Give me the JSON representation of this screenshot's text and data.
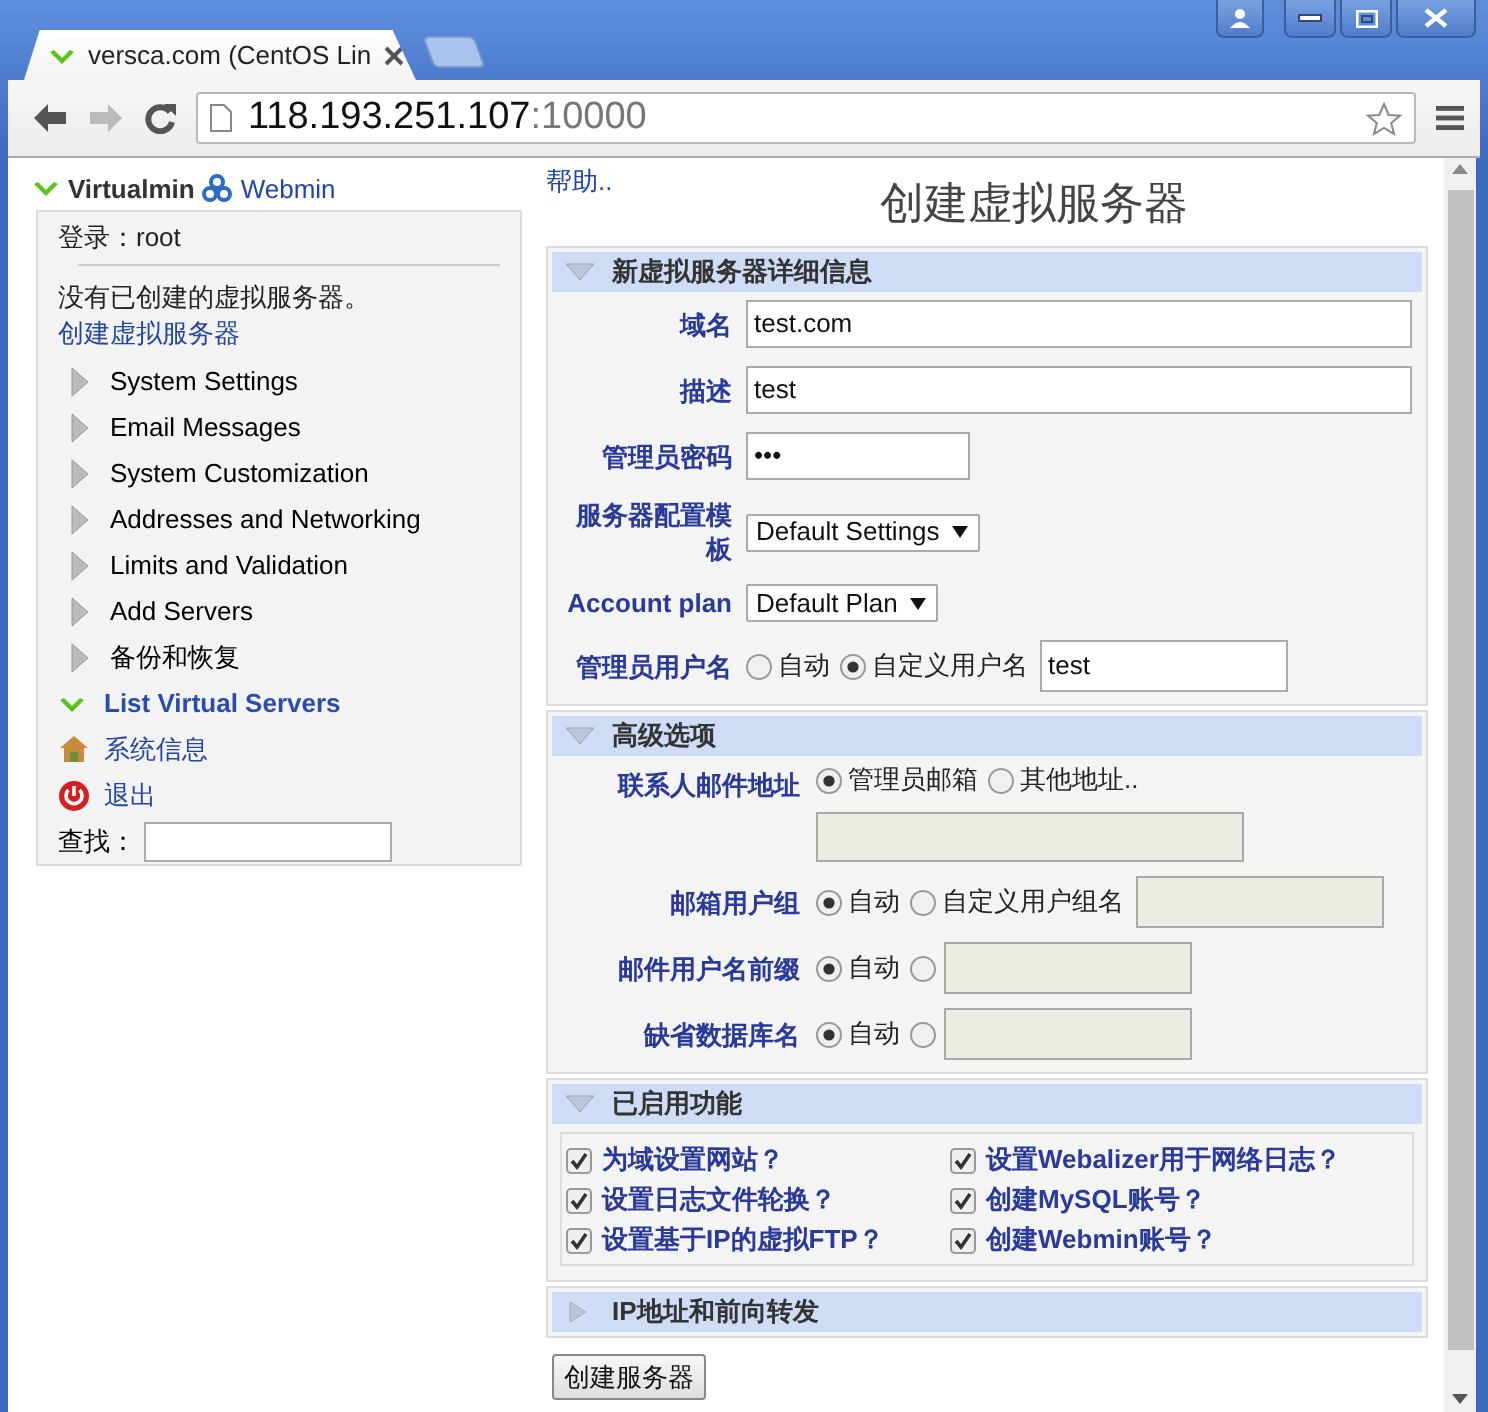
{
  "browser": {
    "tab_title": "versca.com (CentOS Lin",
    "url_host": "118.193.251.107",
    "url_port": ":10000"
  },
  "sidebar": {
    "brand": "Virtualmin",
    "webmin": "Webmin",
    "login": "登录：root",
    "notice": "没有已创建的虚拟服务器。",
    "create_link": "创建虚拟服务器",
    "menu": [
      {
        "label": "System Settings",
        "kind": "category"
      },
      {
        "label": "Email Messages",
        "kind": "category"
      },
      {
        "label": "System Customization",
        "kind": "category"
      },
      {
        "label": "Addresses and Networking",
        "kind": "category"
      },
      {
        "label": "Limits and Validation",
        "kind": "category"
      },
      {
        "label": "Add Servers",
        "kind": "category"
      },
      {
        "label": "备份和恢复",
        "kind": "category"
      },
      {
        "label": "List Virtual Servers",
        "kind": "open"
      },
      {
        "label": "系统信息",
        "kind": "home"
      },
      {
        "label": "退出",
        "kind": "logout"
      }
    ],
    "search_label": "查找："
  },
  "help_link": "帮助..",
  "page_title": "创建虚拟服务器",
  "sections": [
    {
      "title": "新虚拟服务器详细信息",
      "expanded": true,
      "rows": [
        {
          "kind": "text",
          "label": "域名",
          "value": "test.com"
        },
        {
          "kind": "text",
          "label": "描述",
          "value": "test"
        },
        {
          "kind": "password",
          "label": "管理员密码",
          "value": "•••"
        },
        {
          "kind": "select",
          "label": "服务器配置模板",
          "value": "Default Settings"
        },
        {
          "kind": "select",
          "label": "Account plan",
          "value": "Default Plan"
        },
        {
          "kind": "radio",
          "label": "管理员用户名",
          "options": [
            {
              "label": "自动",
              "selected": false
            },
            {
              "label": "自定义用户名",
              "selected": true
            }
          ],
          "field": {
            "value": "test",
            "disabled": false
          }
        }
      ]
    },
    {
      "title": "高级选项",
      "expanded": true,
      "rows": [
        {
          "kind": "radio_stacked",
          "label": "联系人邮件地址",
          "options": [
            {
              "label": "管理员邮箱",
              "selected": true
            },
            {
              "label": "其他地址..",
              "selected": false
            }
          ],
          "field": {
            "disabled": true
          }
        },
        {
          "kind": "radio",
          "label": "邮箱用户组",
          "options": [
            {
              "label": "自动",
              "selected": true
            },
            {
              "label": "自定义用户组名",
              "selected": false
            }
          ],
          "field": {
            "disabled": true
          }
        },
        {
          "kind": "radio",
          "label": "邮件用户名前缀",
          "options": [
            {
              "label": "自动",
              "selected": true
            },
            {
              "selected": false
            }
          ],
          "field": {
            "disabled": true
          }
        },
        {
          "kind": "radio",
          "label": "缺省数据库名",
          "options": [
            {
              "label": "自动",
              "selected": true
            },
            {
              "selected": false
            }
          ],
          "field": {
            "disabled": true
          }
        }
      ]
    },
    {
      "title": "已启用功能",
      "expanded": true,
      "features": [
        {
          "label": "为域设置网站？",
          "checked": true
        },
        {
          "label": "设置Webalizer用于网络日志？",
          "checked": true
        },
        {
          "label": "设置日志文件轮换？",
          "checked": true
        },
        {
          "label": "创建MySQL账号？",
          "checked": true
        },
        {
          "label": "设置基于IP的虚拟FTP？",
          "checked": true
        },
        {
          "label": "创建Webmin账号？",
          "checked": true
        }
      ]
    },
    {
      "title": "IP地址和前向转发",
      "expanded": false
    }
  ],
  "submit": "创建服务器"
}
